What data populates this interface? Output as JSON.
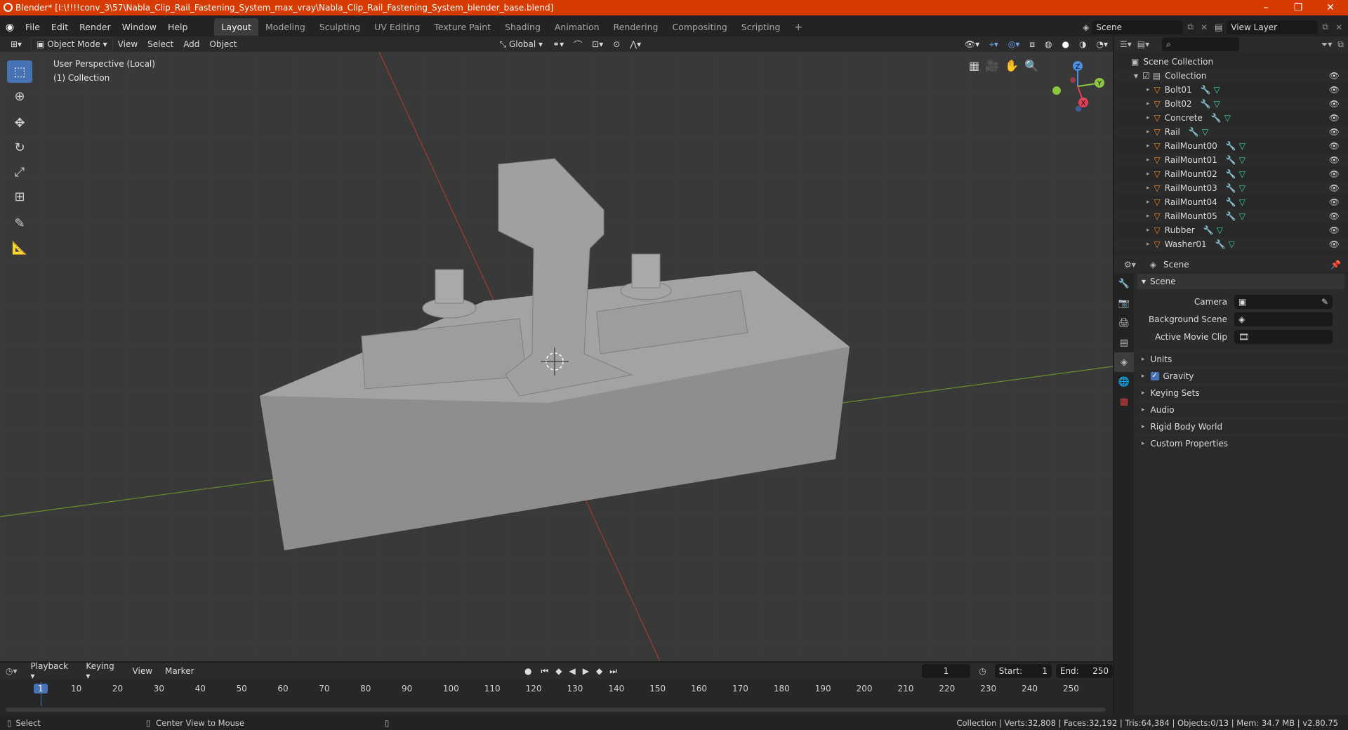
{
  "window": {
    "title": "Blender* [I:\\!!!!conv_3\\57\\Nabla_Clip_Rail_Fastening_System_max_vray\\Nabla_Clip_Rail_Fastening_System_blender_base.blend]",
    "minimize": "–",
    "maximize": "❐",
    "close": "✕"
  },
  "menu": [
    "File",
    "Edit",
    "Render",
    "Window",
    "Help"
  ],
  "workspaces": [
    "Layout",
    "Modeling",
    "Sculpting",
    "UV Editing",
    "Texture Paint",
    "Shading",
    "Animation",
    "Rendering",
    "Compositing",
    "Scripting"
  ],
  "active_workspace": "Layout",
  "scene_selector": "Scene",
  "view_layer": "View Layer",
  "viewport_header": {
    "mode": "Object Mode",
    "menus": [
      "View",
      "Select",
      "Add",
      "Object"
    ],
    "orientation": "Global"
  },
  "viewport": {
    "perspective": "User Perspective (Local)",
    "collection": "(1) Collection",
    "gizmo": {
      "z": "Z",
      "y": "Y",
      "x": "X"
    }
  },
  "outliner": {
    "root": "Scene Collection",
    "collection": "Collection",
    "items": [
      "Bolt01",
      "Bolt02",
      "Concrete",
      "Rail",
      "RailMount00",
      "RailMount01",
      "RailMount02",
      "RailMount03",
      "RailMount04",
      "RailMount05",
      "Rubber",
      "Washer01"
    ]
  },
  "properties": {
    "context": "Scene",
    "panel_title": "Scene",
    "camera_label": "Camera",
    "background_scene_label": "Background Scene",
    "active_movie_clip_label": "Active Movie Clip",
    "sections": [
      "Units",
      "Gravity",
      "Keying Sets",
      "Audio",
      "Rigid Body World",
      "Custom Properties"
    ]
  },
  "timeline": {
    "menus": [
      "Playback",
      "Keying",
      "View",
      "Marker"
    ],
    "current_frame": "1",
    "start_label": "Start:",
    "start": "1",
    "end_label": "End:",
    "end": "250",
    "ticks": [
      "1",
      "10",
      "20",
      "30",
      "40",
      "50",
      "60",
      "70",
      "80",
      "90",
      "100",
      "110",
      "120",
      "130",
      "140",
      "150",
      "160",
      "170",
      "180",
      "190",
      "200",
      "210",
      "220",
      "230",
      "240",
      "250"
    ]
  },
  "status": {
    "left": "Select",
    "middle": "Center View to Mouse",
    "right": "Collection | Verts:32,808 | Faces:32,192 | Tris:64,384 | Objects:0/13 | Mem: 34.7 MB | v2.80.75"
  },
  "colors": {
    "titlebar": "#d83b01",
    "accent": "#4772b3",
    "mesh_icon": "#e8882e",
    "data_icon": "#3ad1a0"
  }
}
